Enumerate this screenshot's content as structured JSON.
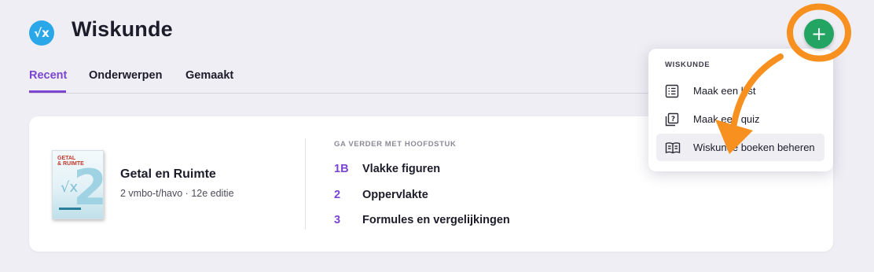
{
  "header": {
    "subject_icon_symbol": "√x",
    "subject_icon": "square-root-icon",
    "title": "Wiskunde"
  },
  "tabs": [
    {
      "label": "Recent",
      "active": true
    },
    {
      "label": "Onderwerpen",
      "active": false
    },
    {
      "label": "Gemaakt",
      "active": false
    }
  ],
  "book": {
    "cover_brand_line1": "GETAL",
    "cover_brand_line2": "& RUIMTE",
    "cover_number": "2",
    "title": "Getal en Ruimte",
    "subtitle": "2 vmbo-t/havo · 12e editie"
  },
  "continue_section": {
    "label": "GA VERDER MET HOOFDSTUK",
    "chapters": [
      {
        "number": "1B",
        "title": "Vlakke figuren"
      },
      {
        "number": "2",
        "title": "Oppervlakte"
      },
      {
        "number": "3",
        "title": "Formules en vergelijkingen"
      }
    ]
  },
  "add_button": {
    "symbol": "+",
    "color": "#23a463"
  },
  "menu": {
    "header": "WISKUNDE",
    "items": [
      {
        "label": "Maak een lijst",
        "icon": "list-icon"
      },
      {
        "label": "Maak een quiz",
        "icon": "quiz-icon"
      },
      {
        "label": "Wiskunde boeken beheren",
        "icon": "book-icon"
      }
    ]
  },
  "colors": {
    "accent": "#7a45d0",
    "annotation": "#f7901e",
    "subject_icon": "#2aa7e8"
  }
}
